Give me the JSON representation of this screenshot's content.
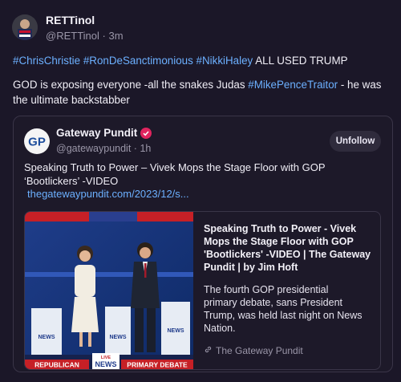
{
  "post": {
    "display_name": "RETTinol",
    "handle": "@RETTinol",
    "separator": "·",
    "time": "3m",
    "line1_tags": [
      "#ChrisChristie",
      "#RonDeSanctimonious",
      "#NikkiHaley"
    ],
    "line1_suffix": " ALL USED TRUMP",
    "line2_prefix": "GOD is exposing everyone -all the snakes Judas ",
    "line2_tag": "#MikePenceTraitor",
    "line2_suffix": " - he was",
    "line3": "the ultimate backstabber"
  },
  "quote": {
    "display_name": "Gateway Pundit",
    "avatar_text": "GP",
    "handle": "@gatewaypundit",
    "separator": "·",
    "time": "1h",
    "unfollow_label": "Unfollow",
    "text_line1": "Speaking Truth to Power – Vivek Mops the Stage Floor with GOP",
    "text_line2": "‘Bootlickers’ -VIDEO",
    "link": "thegatewaypundit.com/2023/12/s..."
  },
  "card": {
    "title": "Speaking Truth to Power - Vivek Mops the Stage Floor with GOP 'Bootlickers' -VIDEO | The Gateway Pundit | by Jim Hoft",
    "description": "The fourth GOP presidential primary debate, sans President Trump, was held last night on News Nation.",
    "source": "The Gateway Pundit",
    "image": {
      "banner_left": "REPUBLICAN",
      "banner_right": "PRIMARY DEBATE",
      "network": "NEWS",
      "live": "LIVE",
      "podium": "NEWS"
    }
  },
  "colors": {
    "background": "#1b1728",
    "link": "#6cb0ff",
    "verified": "#e0245e",
    "muted": "#9a96a8"
  },
  "icons": [
    "verified-badge-icon",
    "link-icon"
  ]
}
